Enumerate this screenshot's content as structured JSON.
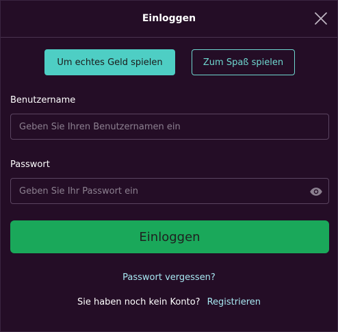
{
  "header": {
    "title": "Einloggen",
    "close_icon": "close-icon"
  },
  "mode": {
    "real_label": "Um echtes Geld spielen",
    "fun_label": "Zum Spaß spielen",
    "active": "real"
  },
  "form": {
    "username_label": "Benutzername",
    "username_placeholder": "Geben Sie Ihren Benutzernamen ein",
    "username_value": "",
    "password_label": "Passwort",
    "password_placeholder": "Geben Sie Ihr Passwort ein",
    "password_value": "",
    "password_toggle_icon": "eye-icon",
    "submit_label": "Einloggen"
  },
  "footer": {
    "forgot_label": "Passwort vergessen?",
    "no_account_text": "Sie haben noch kein Konto?",
    "register_label": "Registrieren"
  },
  "colors": {
    "background": "#240d26",
    "accent_teal": "#4ecec4",
    "submit_green": "#1aa85a",
    "link": "#a8e8f2"
  }
}
